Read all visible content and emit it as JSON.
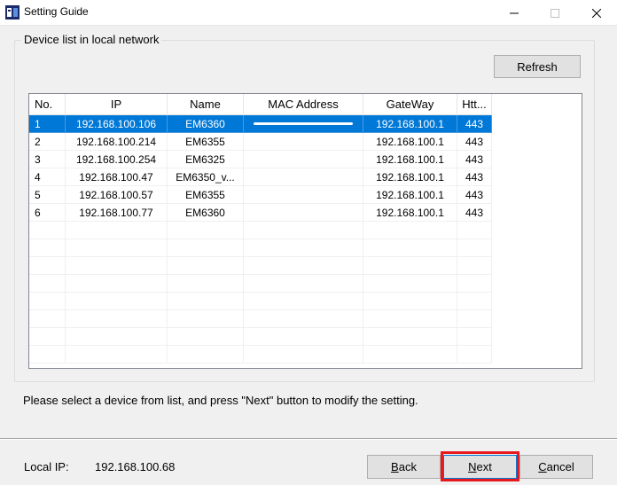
{
  "window": {
    "title": "Setting Guide"
  },
  "group": {
    "label": "Device list in local network"
  },
  "refresh_label": "Refresh",
  "columns": [
    {
      "label": "No.",
      "width": 41
    },
    {
      "label": "IP",
      "width": 115
    },
    {
      "label": "Name",
      "width": 86
    },
    {
      "label": "MAC Address",
      "width": 135
    },
    {
      "label": "GateWay",
      "width": 106
    },
    {
      "label": "Htt...",
      "width": 39
    }
  ],
  "devices": [
    {
      "no": "1",
      "ip": "192.168.100.106",
      "name": "EM6360",
      "mac": "",
      "gateway": "192.168.100.1",
      "http": "443",
      "selected": true
    },
    {
      "no": "2",
      "ip": "192.168.100.214",
      "name": "EM6355",
      "mac": "",
      "gateway": "192.168.100.1",
      "http": "443"
    },
    {
      "no": "3",
      "ip": "192.168.100.254",
      "name": "EM6325",
      "mac": "",
      "gateway": "192.168.100.1",
      "http": "443"
    },
    {
      "no": "4",
      "ip": "192.168.100.47",
      "name": "EM6350_v...",
      "mac": "",
      "gateway": "192.168.100.1",
      "http": "443"
    },
    {
      "no": "5",
      "ip": "192.168.100.57",
      "name": "EM6355",
      "mac": "",
      "gateway": "192.168.100.1",
      "http": "443"
    },
    {
      "no": "6",
      "ip": "192.168.100.77",
      "name": "EM6360",
      "mac": "",
      "gateway": "192.168.100.1",
      "http": "443"
    }
  ],
  "empty_rows": 8,
  "hint": "Please select a device from list, and press \"Next\" button to modify the setting.",
  "local_ip": {
    "label": "Local IP:",
    "value": "192.168.100.68"
  },
  "buttons": {
    "back": {
      "accel": "B",
      "rest": "ack"
    },
    "next": {
      "accel": "N",
      "rest": "ext"
    },
    "cancel": {
      "accel": "C",
      "rest": "ancel"
    }
  },
  "colors": {
    "selection": "#0078d7",
    "highlight": "#e8171c"
  }
}
